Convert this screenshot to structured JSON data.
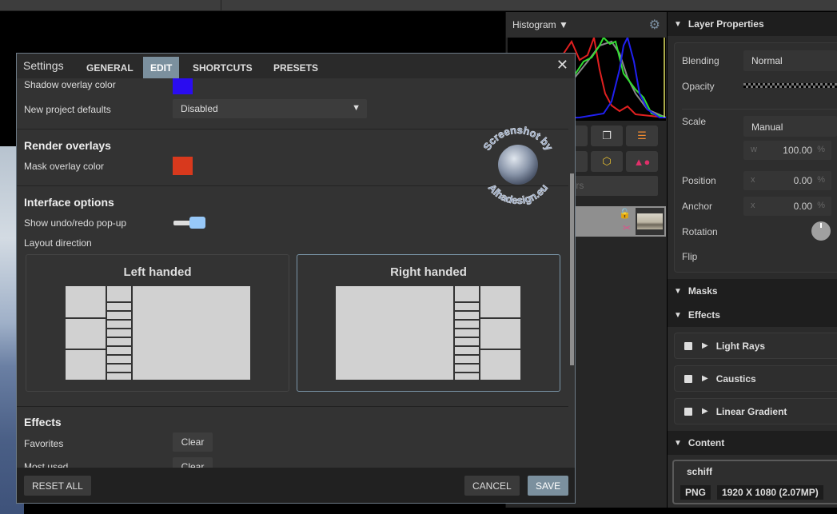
{
  "topbar": {},
  "histogram_panel": {
    "title": "Histogram",
    "dropdown_icon": "caret-down-icon",
    "settings_icon": "gear-icon",
    "search_placeholder": "Search layers",
    "search_visible_text": "ayers",
    "layer": {
      "lock_icon": "unlock-icon",
      "scissors_icon": "scissors-icon"
    }
  },
  "properties": {
    "layer_properties_title": "Layer Properties",
    "blending_label": "Blending",
    "blending_value": "Normal",
    "opacity_label": "Opacity",
    "scale_label": "Scale",
    "scale_mode": "Manual",
    "scale_w_axis": "w",
    "scale_w_value": "100.00",
    "position_label": "Position",
    "position_x_axis": "x",
    "position_x_value": "0.00",
    "anchor_label": "Anchor",
    "anchor_x_axis": "x",
    "anchor_x_value": "0.00",
    "percent_unit": "%",
    "rotation_label": "Rotation",
    "flip_label": "Flip",
    "masks_title": "Masks",
    "effects_title": "Effects",
    "effects": [
      {
        "label": "Light Rays"
      },
      {
        "label": "Caustics"
      },
      {
        "label": "Linear Gradient"
      }
    ],
    "content_title": "Content",
    "content": {
      "name": "schiff",
      "format": "PNG",
      "dimensions": "1920 X 1080 (2.07MP)"
    }
  },
  "dialog": {
    "title": "Settings",
    "tabs": [
      {
        "label": "GENERAL",
        "active": false
      },
      {
        "label": "EDIT",
        "active": true
      },
      {
        "label": "SHORTCUTS",
        "active": false
      },
      {
        "label": "PRESETS",
        "active": false
      }
    ],
    "close_icon": "close-icon",
    "shadow_overlay_label": "Shadow overlay color",
    "shadow_overlay_color": "#2a0cf0",
    "new_project_label": "New project defaults",
    "new_project_value": "Disabled",
    "render_overlays_title": "Render overlays",
    "mask_overlay_label": "Mask overlay color",
    "mask_overlay_color": "#d8391d",
    "interface_title": "Interface options",
    "undo_popup_label": "Show undo/redo pop-up",
    "undo_popup_enabled": true,
    "layout_direction_label": "Layout direction",
    "layout_options": [
      {
        "label": "Left handed",
        "selected": false
      },
      {
        "label": "Right handed",
        "selected": true
      }
    ],
    "effects_title": "Effects",
    "favorites_label": "Favorites",
    "clear_label": "Clear",
    "most_used_label": "Most used",
    "reset_all_label": "RESET ALL",
    "cancel_label": "CANCEL",
    "save_label": "SAVE"
  },
  "watermark": {
    "top_text": "Screenshot by",
    "bottom_text": "Alhadesign.eu"
  },
  "colors": {
    "accent": "#7b909e",
    "toggle_on": "#97c8f8"
  }
}
